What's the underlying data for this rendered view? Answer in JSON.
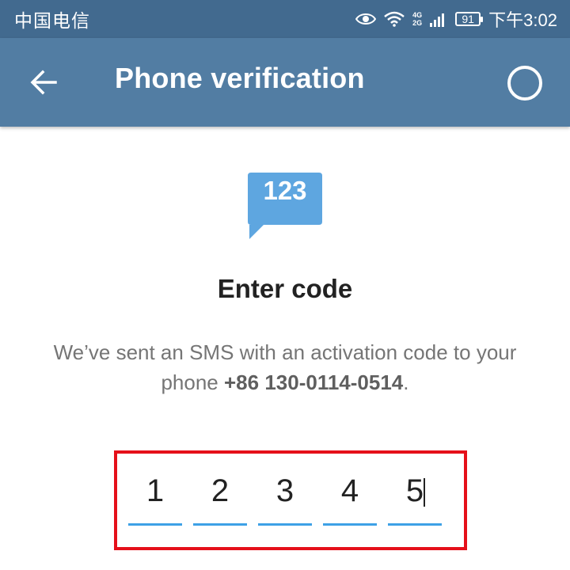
{
  "status_bar": {
    "carrier": "中国电信",
    "network_type_top": "4G",
    "network_type_bottom": "2G",
    "battery_level": "91",
    "time": "下午3:02",
    "icons": [
      "eye-icon",
      "wifi-icon",
      "signal-icon",
      "battery-icon"
    ]
  },
  "app_bar": {
    "title": "Phone verification",
    "back_icon": "arrow-left-icon",
    "progress_icon": "progress-ring-icon"
  },
  "content": {
    "sms_icon_text": "123",
    "heading": "Enter code",
    "description_prefix": "We’ve sent an SMS with an activation code to your phone ",
    "phone_number": "+86 130-0114-0514",
    "description_suffix": ".",
    "code_digits": [
      "1",
      "2",
      "3",
      "4",
      "5"
    ]
  },
  "colors": {
    "status_bar": "#426a8f",
    "app_bar": "#527da3",
    "sms_icon": "#5ea6e0",
    "code_underline": "#3ea1e6",
    "highlight_box": "#e5101a"
  }
}
